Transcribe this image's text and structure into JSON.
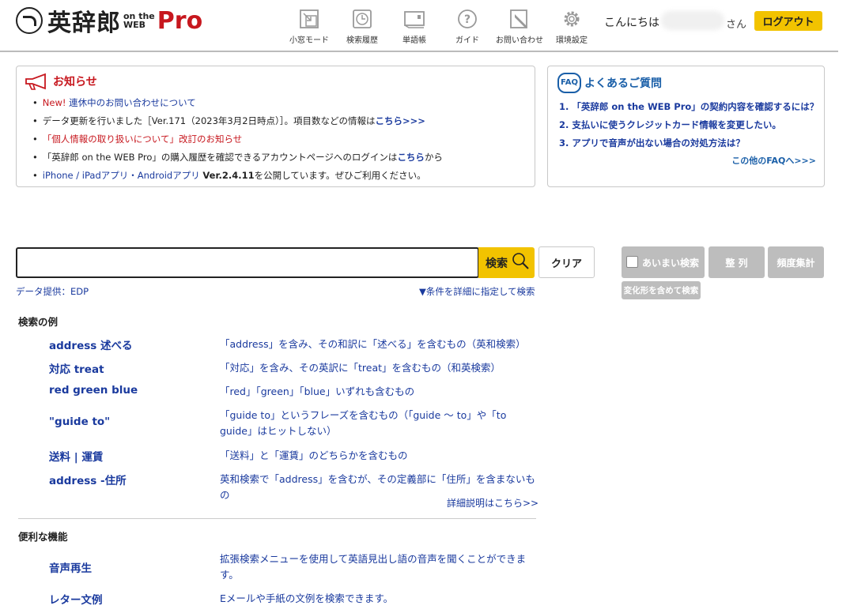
{
  "header": {
    "logo_text": "英辞郎",
    "logo_sub_top": "on the",
    "logo_sub_bottom": "WEB",
    "logo_pro": "Pro",
    "nav": [
      {
        "label": "小窓モード"
      },
      {
        "label": "検索履歴"
      },
      {
        "label": "単語帳"
      },
      {
        "label": "ガイド"
      },
      {
        "label": "お問い合わせ"
      },
      {
        "label": "環境設定"
      }
    ],
    "greeting": "こんにちは",
    "greeting_suffix": "さん",
    "logout_label": "ログアウト"
  },
  "notice": {
    "title": "お知らせ",
    "items": [
      {
        "tag": "New!",
        "text": "連休中のお問い合わせについて"
      },
      {
        "text": "データ更新を行いました［Ver.171（2023年3月2日時点）］。項目数などの情報は",
        "link": "こちら>>>"
      },
      {
        "text": "「個人情報の取り扱いについて」改訂のお知らせ"
      },
      {
        "text": "「英辞郎 on the WEB Pro」の購入履歴を確認できるアカウントページへのログインは",
        "link": "こちら",
        "suffix": "から"
      },
      {
        "text": "iPhone / iPadアプリ・Androidアプリ ",
        "version": "Ver.2.4.11",
        "suffix": "を公開しています。ぜひご利用ください。"
      }
    ]
  },
  "faq": {
    "icon": "FAQ",
    "title": "よくあるご質問",
    "items": [
      "1. 「英辞郎 on the WEB Pro」の契約内容を確認するには？",
      "2. 支払いに使うクレジットカード情報を変更したい。",
      "3. アプリで音声が出ない場合の対処方法は？"
    ],
    "more_link": "この他のFAQへ>>>"
  },
  "search": {
    "input_value": "",
    "search_label": "検索",
    "clear_label": "クリア",
    "fuzzy_label": "あいまい検索",
    "fuzzy_checked": false,
    "sort_label": "整 列",
    "freq_label": "頻度集計",
    "inflect_label": "変化形を含めて検索",
    "data_source": "データ提供：EDP",
    "advanced_link": "▼条件を詳細に指定して検索"
  },
  "examples": {
    "title": "検索の例",
    "rows": [
      {
        "term": "address 述べる",
        "desc": "「address」を含み、その和訳に「述べる」を含むもの（英和検索）"
      },
      {
        "term": "対応 treat",
        "desc": "「対応」を含み、その英訳に「treat」を含むもの（和英検索）"
      },
      {
        "term": "red green blue",
        "desc": "「red」「green」「blue」いずれも含むもの"
      },
      {
        "term": "\"guide to\"",
        "desc": "「guide to」というフレーズを含むもの（「guide ～ to」や「to guide」はヒットしない）"
      },
      {
        "term": "送料 | 運賃",
        "desc": "「送料」と「運賃」のどちらかを含むもの"
      },
      {
        "term": "address -住所",
        "desc": "英和検索で「address」を含むが、その定義部に「住所」を含まないもの"
      }
    ],
    "detail_link": "詳細説明はこちら>>"
  },
  "features": {
    "title": "便利な機能",
    "rows": [
      {
        "term": "音声再生",
        "desc": "拡張検索メニューを使用して英語見出し語の音声を聞くことができます。"
      },
      {
        "term": "レター文例",
        "desc": "Eメールや手紙の文例を検索できます。"
      }
    ]
  },
  "colors": {
    "accent_yellow": "#f2c300",
    "notice_red": "#c7171e",
    "link_blue": "#1a3a9e",
    "faq_blue": "#1a5fa8",
    "disabled_gray": "#bdbdbd"
  }
}
